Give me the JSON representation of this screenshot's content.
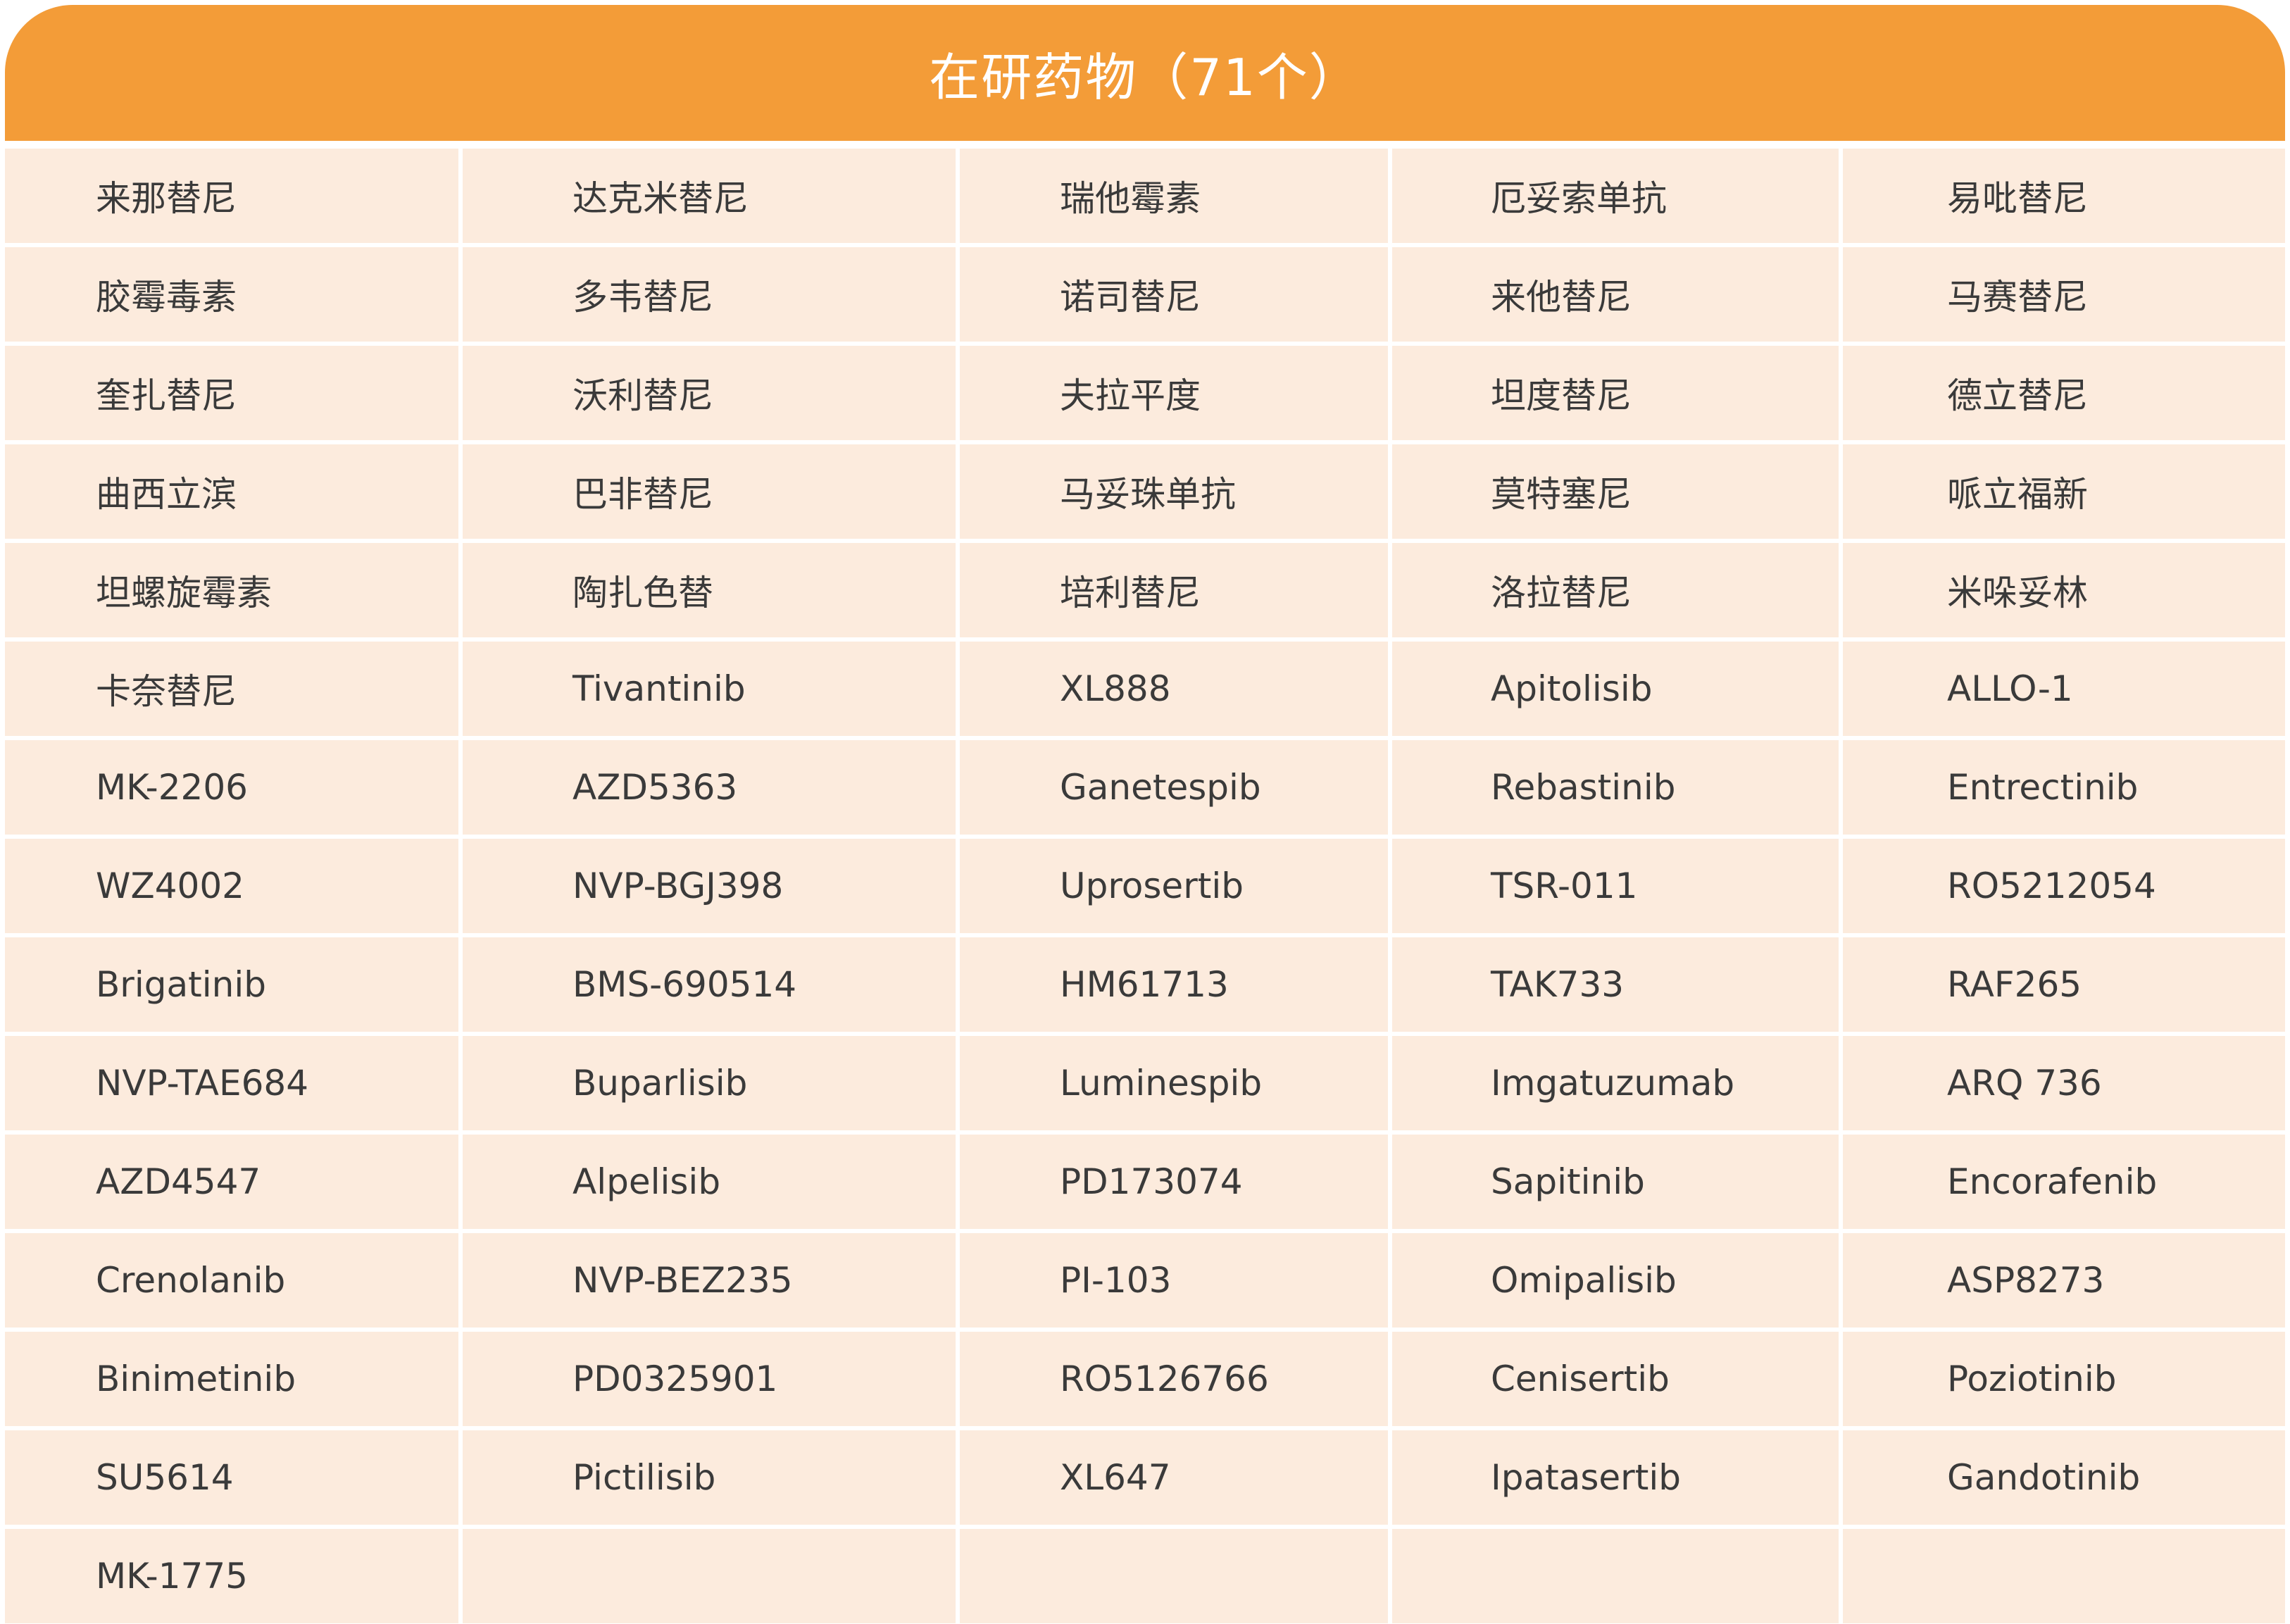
{
  "header": {
    "title": "在研药物（71个）"
  },
  "table": {
    "rows": [
      [
        "来那替尼",
        "达克米替尼",
        "瑞他霉素",
        "厄妥索单抗",
        "易吡替尼"
      ],
      [
        "胶霉毒素",
        "多韦替尼",
        "诺司替尼",
        "来他替尼",
        "马赛替尼"
      ],
      [
        "奎扎替尼",
        "沃利替尼",
        "夫拉平度",
        "坦度替尼",
        "德立替尼"
      ],
      [
        "曲西立滨",
        "巴非替尼",
        "马妥珠单抗",
        "莫特塞尼",
        "哌立福新"
      ],
      [
        "坦螺旋霉素",
        "陶扎色替",
        "培利替尼",
        "洛拉替尼",
        "米哚妥林"
      ],
      [
        "卡奈替尼",
        "Tivantinib",
        "XL888",
        "Apitolisib",
        "ALLO-1"
      ],
      [
        "MK-2206",
        "AZD5363",
        "Ganetespib",
        "Rebastinib",
        "Entrectinib"
      ],
      [
        "WZ4002",
        "NVP-BGJ398",
        "Uprosertib",
        "TSR-011",
        "RO5212054"
      ],
      [
        "Brigatinib",
        "BMS-690514",
        "HM61713",
        "TAK733",
        "RAF265"
      ],
      [
        "NVP-TAE684",
        "Buparlisib",
        "Luminespib",
        "Imgatuzumab",
        "ARQ  736"
      ],
      [
        "AZD4547",
        "Alpelisib",
        "PD173074",
        "Sapitinib",
        "Encorafenib"
      ],
      [
        "Crenolanib",
        "NVP-BEZ235",
        "PI-103",
        "Omipalisib",
        "ASP8273"
      ],
      [
        "Binimetinib",
        "PD0325901",
        "RO5126766",
        "Cenisertib",
        "Poziotinib"
      ],
      [
        "SU5614",
        "Pictilisib",
        "XL647",
        "Ipatasertib",
        "Gandotinib"
      ],
      [
        "MK-1775",
        "",
        "",
        "",
        ""
      ]
    ]
  },
  "colors": {
    "header_bg": "#f39c38",
    "cell_bg": "#fcebdd",
    "text": "#3a3a3a"
  }
}
